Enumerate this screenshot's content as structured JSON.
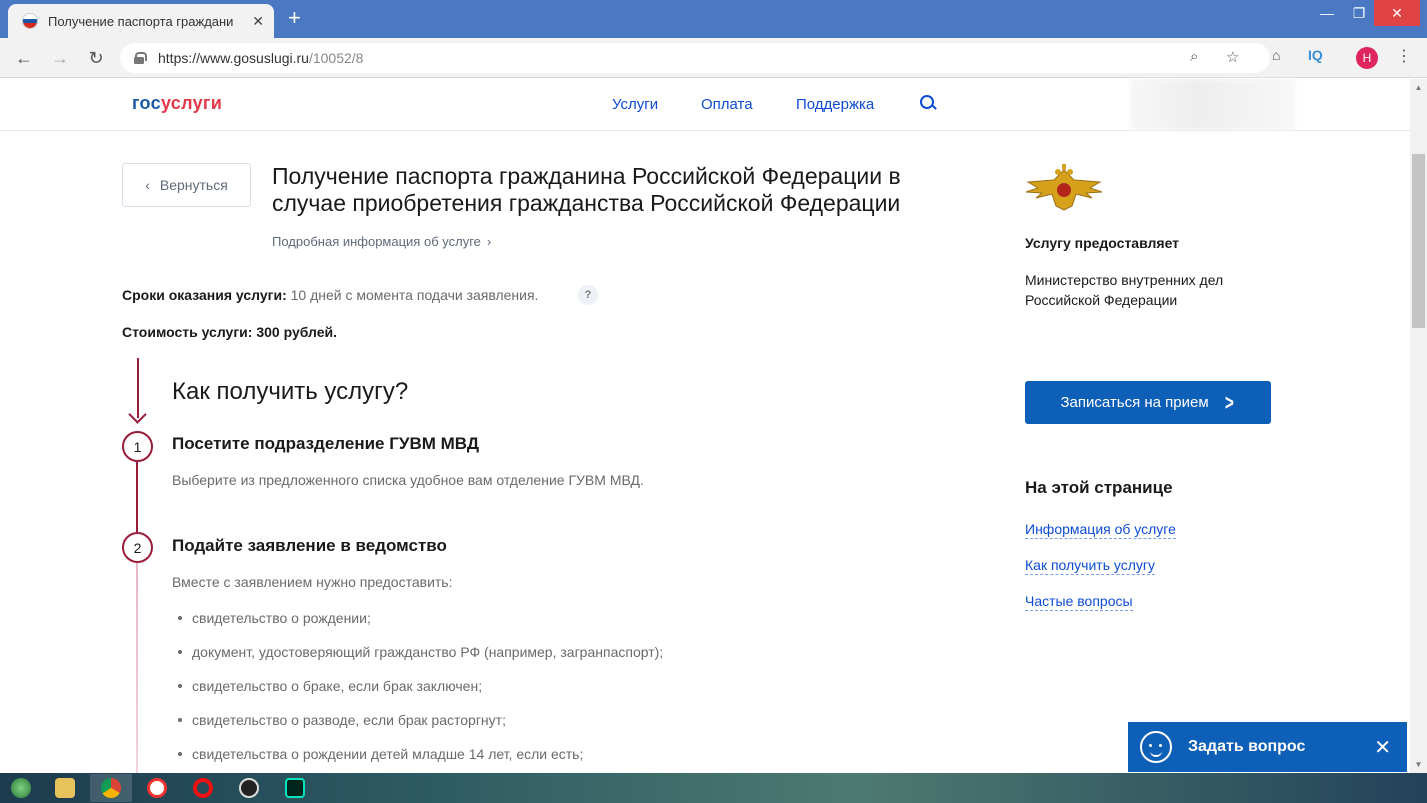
{
  "browser": {
    "tab_title": "Получение паспорта граждани",
    "tab_close": "✕",
    "new_tab": "+",
    "url_host": "https://www.gosuslugi.ru",
    "url_path": "/10052/8",
    "profile_initial": "Н",
    "ext_iq": "IQ"
  },
  "site": {
    "logo_gos": "гос",
    "logo_uslugi": "услуги",
    "nav": [
      "Услуги",
      "Оплата",
      "Поддержка"
    ]
  },
  "main": {
    "back_label": "Вернуться",
    "title": "Получение паспорта гражданина Российской Федерации в случае приобретения гражданства Российской Федерации",
    "detail_link": "Подробная информация об услуге",
    "terms_label": "Сроки оказания услуги:",
    "terms_value": "10 дней с момента подачи заявления.",
    "help": "?",
    "cost": "Стоимость услуги: 300 рублей.",
    "how_title": "Как получить услугу?",
    "steps": [
      {
        "number": "1",
        "title": "Посетите подразделение ГУВМ МВД",
        "text": "Выберите из предложенного списка удобное вам отделение ГУВМ МВД."
      },
      {
        "number": "2",
        "title": "Подайте заявление в ведомство",
        "text": "Вместе с заявлением нужно предоставить:",
        "documents": [
          "свидетельство о рождении;",
          "документ, удостоверяющий гражданство РФ (например, загранпаспорт);",
          "свидетельство о браке, если брак заключен;",
          "свидетельство о разводе, если брак расторгнут;",
          "свидетельства о рождении детей младше 14 лет, если есть;"
        ]
      }
    ]
  },
  "sidebar": {
    "provider_label": "Услугу предоставляет",
    "provider_name": "Министерство внутренних дел Российской Федерации",
    "cta_label": "Записаться на прием",
    "onpage_title": "На этой странице",
    "onpage_links": [
      "Информация об услуге",
      "Как получить услугу",
      "Частые вопросы"
    ]
  },
  "chat": {
    "label": "Задать вопрос",
    "close": "✕"
  },
  "colors": {
    "brand_blue": "#0d5fb8",
    "link_blue": "#0d4cd3",
    "timeline_red": "#9b1c3a",
    "logo_red": "#e2394a"
  }
}
